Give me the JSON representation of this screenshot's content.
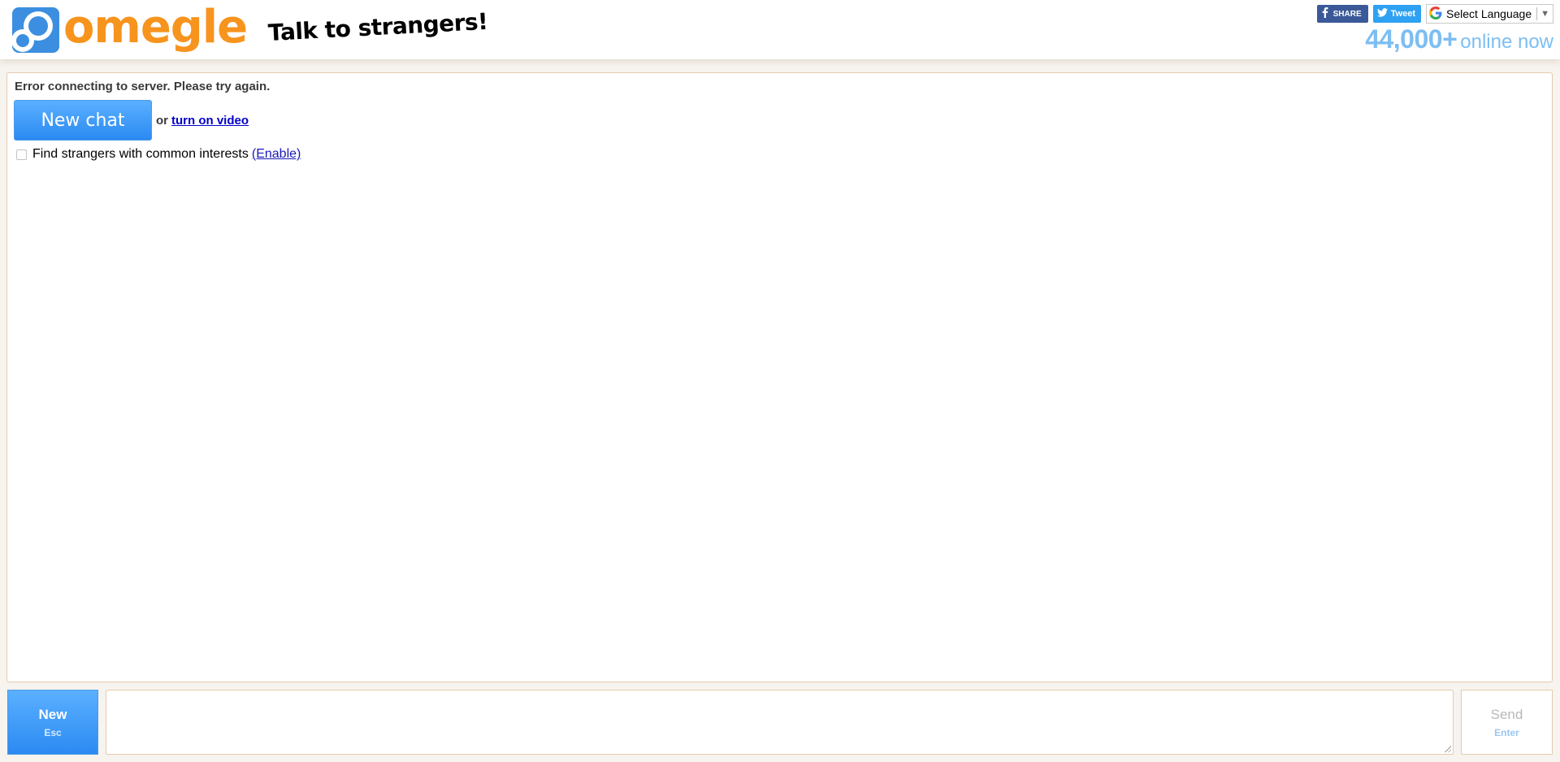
{
  "header": {
    "logo_text": "omegle",
    "tagline": "Talk to strangers!",
    "share_label": "SHARE",
    "tweet_label": "Tweet",
    "language_select": "Select Language",
    "online_count": "44,000+",
    "online_label": "online now"
  },
  "colors": {
    "brand_orange": "#f7941d",
    "brand_blue": "#2b8af2",
    "facebook": "#3b5998",
    "twitter": "#2ea1f2",
    "online_text": "#7dbef2"
  },
  "log": {
    "status_message": "Error connecting to server. Please try again.",
    "new_chat_button": "New chat",
    "or_text": "or",
    "video_link": "turn on video",
    "interests_label": "Find strangers with common interests",
    "enable_link": "(Enable)"
  },
  "controls": {
    "new_label": "New",
    "new_shortcut": "Esc",
    "send_label": "Send",
    "send_shortcut": "Enter",
    "message_value": ""
  }
}
